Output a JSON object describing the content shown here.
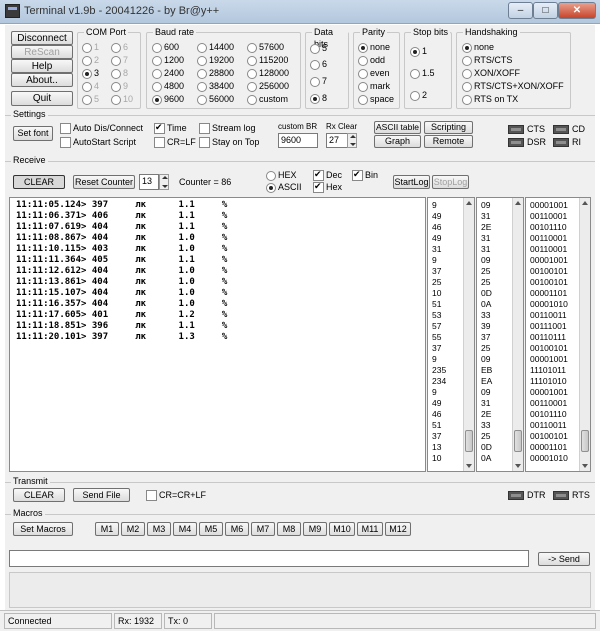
{
  "window": {
    "title": "Terminal v1.9b - 20041226 - by Br@y++",
    "min": "–",
    "max": "□",
    "close": "✕"
  },
  "conn": {
    "disconnect": "Disconnect",
    "rescan": "ReScan",
    "help": "Help",
    "about": "About..",
    "quit": "Quit"
  },
  "com_port": {
    "title": "COM Port",
    "options": [
      "1",
      "2",
      "3",
      "4",
      "5",
      "6",
      "7",
      "8",
      "9",
      "10"
    ],
    "selected": "3"
  },
  "baud": {
    "title": "Baud rate",
    "options": [
      "600",
      "1200",
      "2400",
      "4800",
      "9600",
      "14400",
      "19200",
      "28800",
      "38400",
      "56000",
      "57600",
      "115200",
      "128000",
      "256000",
      "custom"
    ],
    "selected": "9600"
  },
  "data_bits": {
    "title": "Data bits",
    "options": [
      "5",
      "6",
      "7",
      "8"
    ],
    "selected": "8"
  },
  "parity": {
    "title": "Parity",
    "options": [
      "none",
      "odd",
      "even",
      "mark",
      "space"
    ],
    "selected": "none"
  },
  "stop_bits": {
    "title": "Stop bits",
    "options": [
      "1",
      "1.5",
      "2"
    ],
    "selected": "1"
  },
  "handshaking": {
    "title": "Handshaking",
    "options": [
      "none",
      "RTS/CTS",
      "XON/XOFF",
      "RTS/CTS+XON/XOFF",
      "RTS on TX"
    ],
    "selected": "none"
  },
  "settings": {
    "title": "Settings",
    "set_font": "Set font",
    "auto_dis": "Auto Dis/Connect",
    "auto_start": "AutoStart Script",
    "time": "Time",
    "crlf": "CR=LF",
    "stream_log": "Stream log",
    "stay_on_top": "Stay on Top",
    "custom_br_label": "custom BR",
    "custom_br_value": "9600",
    "rx_clear_label": "Rx Clear",
    "rx_clear_value": "27",
    "ascii_table": "ASCII table",
    "graph": "Graph",
    "scripting": "Scripting",
    "remote": "Remote",
    "cts": "CTS",
    "cd": "CD",
    "dsr": "DSR",
    "ri": "RI"
  },
  "receive": {
    "title": "Receive",
    "clear": "CLEAR",
    "reset_counter": "Reset Counter",
    "counter_spin": "13",
    "counter_label": "Counter = 86",
    "hex": "HEX",
    "ascii": "ASCII",
    "dec": "Dec",
    "hex_chk": "Hex",
    "bin": "Bin",
    "startlog": "StartLog",
    "stoplog": "StopLog",
    "lines": [
      "11:11:05.124> 397     лк      1.1     %",
      "11:11:06.371> 406     лк      1.1     %",
      "11:11:07.619> 404     лк      1.1     %",
      "11:11:08.867> 404     лк      1.0     %",
      "11:11:10.115> 403     лк      1.0     %",
      "11:11:11.364> 405     лк      1.1     %",
      "11:11:12.612> 404     лк      1.0     %",
      "11:11:13.861> 404     лк      1.0     %",
      "11:11:15.107> 404     лк      1.0     %",
      "11:11:16.357> 404     лк      1.0     %",
      "11:11:17.605> 401     лк      1.2     %",
      "11:11:18.851> 396     лк      1.1     %",
      "11:11:20.101> 397     лк      1.3     %"
    ],
    "dec_col": [
      "9",
      "49",
      "46",
      "49",
      "31",
      "9",
      "37",
      "25",
      "10",
      "51",
      "53",
      "57",
      "55",
      "37",
      "9",
      "235",
      "234",
      "9",
      "49",
      "46",
      "51",
      "37",
      "13",
      "10"
    ],
    "hex_col": [
      "09",
      "31",
      "2E",
      "31",
      "31",
      "09",
      "25",
      "25",
      "0D",
      "0A",
      "33",
      "39",
      "37",
      "25",
      "09",
      "EB",
      "EA",
      "09",
      "31",
      "2E",
      "33",
      "25",
      "0D",
      "0A"
    ],
    "bin_col": [
      "00001001",
      "00110001",
      "00101110",
      "00110001",
      "00110001",
      "00001001",
      "00100101",
      "00100101",
      "00001101",
      "00001010",
      "00110011",
      "00111001",
      "00110111",
      "00100101",
      "00001001",
      "11101011",
      "11101010",
      "00001001",
      "00110001",
      "00101110",
      "00110011",
      "00100101",
      "00001101",
      "00001010"
    ]
  },
  "transmit": {
    "title": "Transmit",
    "clear": "CLEAR",
    "send_file": "Send File",
    "crcr": "CR=CR+LF",
    "dtr": "DTR",
    "rts": "RTS"
  },
  "macros": {
    "title": "Macros",
    "set_macros": "Set Macros",
    "buttons": [
      "M1",
      "M2",
      "M3",
      "M4",
      "M5",
      "M6",
      "M7",
      "M8",
      "M9",
      "M10",
      "M11",
      "M12"
    ]
  },
  "send": {
    "input_value": "",
    "button": "-> Send"
  },
  "status": {
    "connected": "Connected",
    "rx": "Rx: 1932",
    "tx": "Tx: 0"
  }
}
